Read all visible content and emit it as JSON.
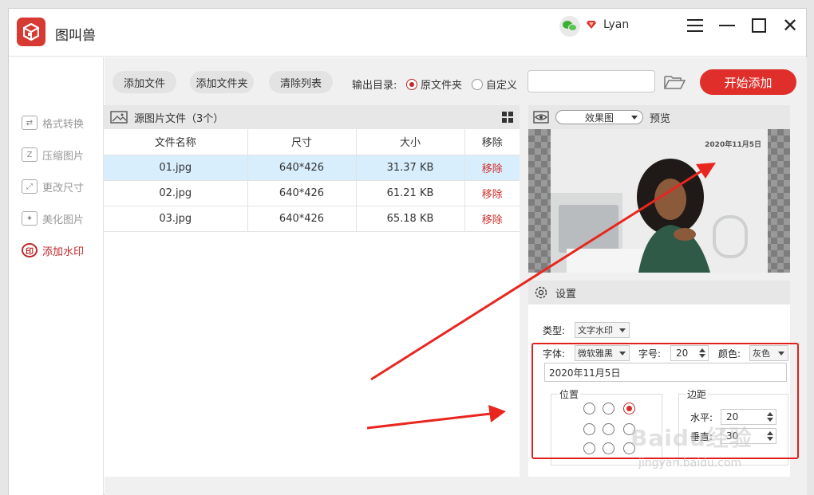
{
  "app": {
    "name": "图叫兽",
    "username": "Lyan"
  },
  "sidebar": {
    "items": [
      {
        "label": "格式转换",
        "glyph": "⇄",
        "active": false
      },
      {
        "label": "压缩图片",
        "glyph": "Z",
        "active": false
      },
      {
        "label": "更改尺寸",
        "glyph": "⤢",
        "active": false
      },
      {
        "label": "美化图片",
        "glyph": "✦",
        "active": false
      },
      {
        "label": "添加水印",
        "glyph": "印",
        "active": true
      }
    ]
  },
  "toolbar": {
    "add_file": "添加文件",
    "add_folder": "添加文件夹",
    "clear_list": "清除列表",
    "output_label": "输出目录:",
    "radio_original": "原文件夹",
    "radio_custom": "自定义",
    "path_value": "",
    "start": "开始添加"
  },
  "file_panel": {
    "title": "源图片文件（3个）",
    "columns": [
      "文件名称",
      "尺寸",
      "大小",
      "移除"
    ],
    "rows": [
      {
        "name": "01.jpg",
        "dims": "640*426",
        "size": "31.37 KB",
        "remove": "移除",
        "selected": true
      },
      {
        "name": "02.jpg",
        "dims": "640*426",
        "size": "61.21 KB",
        "remove": "移除",
        "selected": false
      },
      {
        "name": "03.jpg",
        "dims": "640*426",
        "size": "65.18 KB",
        "remove": "移除",
        "selected": false
      }
    ]
  },
  "preview": {
    "mode": "效果图",
    "label": "预览",
    "watermark_text": "2020年11月5日"
  },
  "settings": {
    "title": "设置",
    "type_label": "类型:",
    "type_value": "文字水印",
    "font_label": "字体:",
    "font_value": "微软雅黑",
    "size_label": "字号:",
    "size_value": "20",
    "color_label": "颜色:",
    "color_value": "灰色",
    "text_value": "2020年11月5日",
    "position_title": "位置",
    "position_selected": "top-right",
    "margin_title": "边距",
    "horizontal_label": "水平:",
    "horizontal_value": "20",
    "vertical_label": "垂直:",
    "vertical_value": "30"
  },
  "overlay": {
    "baidu": "Baidu经验",
    "baidu_sub": "jingyan.baidu.com",
    "arrow_color": "#e8261f"
  },
  "colors": {
    "accent": "#e02f2b",
    "selected_row": "#d8eefc"
  }
}
